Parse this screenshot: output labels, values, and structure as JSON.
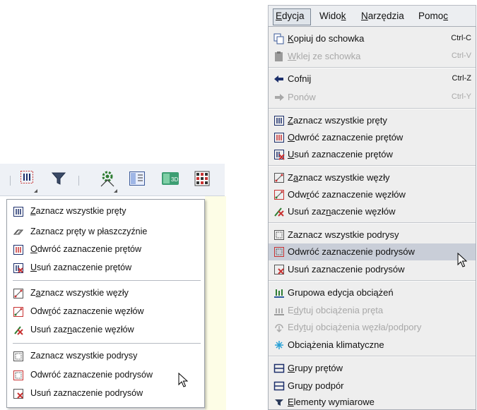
{
  "left_menu": {
    "items": [
      {
        "pre": "",
        "u": "Z",
        "post": "aznacz wszystkie pręty",
        "icon": "bars-grid-icon"
      },
      {
        "pre": "Zaznacz pręty w płaszczyźnie",
        "u": "",
        "post": "",
        "icon": "plane-bars-icon"
      },
      {
        "pre": "",
        "u": "O",
        "post": "dwróć zaznaczenie prętów",
        "icon": "invert-bars-icon"
      },
      {
        "pre": "",
        "u": "U",
        "post": "suń zaznaczenie prętów",
        "icon": "remove-bars-icon"
      },
      {
        "pre": "Z",
        "u": "a",
        "post": "znacz wszystkie węzły",
        "icon": "nodes-icon"
      },
      {
        "pre": "Odw",
        "u": "r",
        "post": "óć zaznaczenie węzłów",
        "icon": "invert-nodes-icon"
      },
      {
        "pre": "Usuń zaz",
        "u": "n",
        "post": "aczenie węzłów",
        "icon": "remove-nodes-icon"
      },
      {
        "pre": "Zaznacz wszystkie podrysy",
        "u": "",
        "post": "",
        "icon": "subdrawings-icon"
      },
      {
        "pre": "Odwróć zaznaczenie podrysów",
        "u": "",
        "post": "",
        "icon": "invert-subdrawings-icon"
      },
      {
        "pre": "Usuń zaznaczenie podrysów",
        "u": "",
        "post": "",
        "icon": "remove-subdrawings-icon"
      }
    ]
  },
  "toolbar": {
    "buttons": [
      "select-dropdown-icon",
      "filter-icon",
      "settings-icon",
      "layout-icon",
      "3d-view-icon",
      "grid-icon"
    ]
  },
  "menubar": {
    "items": [
      {
        "pre": "",
        "u": "E",
        "post": "dycja"
      },
      {
        "pre": "Wido",
        "u": "k",
        "post": ""
      },
      {
        "pre": "",
        "u": "N",
        "post": "arzędzia"
      },
      {
        "pre": "Pomo",
        "u": "c",
        "post": ""
      }
    ]
  },
  "right_menu": {
    "items": [
      {
        "pre": "",
        "u": "K",
        "post": "opiuj do schowka",
        "shortcut": "Ctrl-C",
        "disabled": false,
        "icon": "copy-icon"
      },
      {
        "pre": "",
        "u": "W",
        "post": "klej ze schowka",
        "shortcut": "Ctrl-V",
        "disabled": true,
        "icon": "paste-icon"
      },
      {
        "pre": "Cofnij",
        "u": "",
        "post": "",
        "shortcut": "Ctrl-Z",
        "disabled": false,
        "icon": "undo-icon"
      },
      {
        "pre": "Ponów",
        "u": "",
        "post": "",
        "shortcut": "Ctrl-Y",
        "disabled": true,
        "icon": "redo-icon"
      },
      {
        "pre": "",
        "u": "Z",
        "post": "aznacz wszystkie pręty",
        "shortcut": "",
        "disabled": false,
        "icon": "bars-grid-icon"
      },
      {
        "pre": "",
        "u": "O",
        "post": "dwróć zaznaczenie prętów",
        "shortcut": "",
        "disabled": false,
        "icon": "invert-bars-icon"
      },
      {
        "pre": "",
        "u": "U",
        "post": "suń zaznaczenie prętów",
        "shortcut": "",
        "disabled": false,
        "icon": "remove-bars-icon"
      },
      {
        "pre": "Z",
        "u": "a",
        "post": "znacz wszystkie węzły",
        "shortcut": "",
        "disabled": false,
        "icon": "nodes-icon"
      },
      {
        "pre": "Odw",
        "u": "r",
        "post": "óć zaznaczenie węzłów",
        "shortcut": "",
        "disabled": false,
        "icon": "invert-nodes-icon"
      },
      {
        "pre": "Usuń zaz",
        "u": "n",
        "post": "aczenie węzłów",
        "shortcut": "",
        "disabled": false,
        "icon": "remove-nodes-icon"
      },
      {
        "pre": "Zaznacz wszystkie podrysy",
        "u": "",
        "post": "",
        "shortcut": "",
        "disabled": false,
        "icon": "subdrawings-icon"
      },
      {
        "pre": "Odwróć zaznaczenie podrysów",
        "u": "",
        "post": "",
        "shortcut": "",
        "disabled": false,
        "icon": "invert-subdrawings-icon",
        "highlighted": true
      },
      {
        "pre": "Usuń zaznaczenie podrysów",
        "u": "",
        "post": "",
        "shortcut": "",
        "disabled": false,
        "icon": "remove-subdrawings-icon"
      },
      {
        "pre": "Grupowa edycja obciążeń",
        "u": "",
        "post": "",
        "shortcut": "",
        "disabled": false,
        "icon": "group-loads-icon"
      },
      {
        "pre": "E",
        "u": "d",
        "post": "ytuj obciążenia pręta",
        "shortcut": "",
        "disabled": true,
        "icon": "edit-bar-loads-icon"
      },
      {
        "pre": "Edy",
        "u": "t",
        "post": "uj obciążenia węzła/podpory",
        "shortcut": "",
        "disabled": true,
        "icon": "edit-node-loads-icon"
      },
      {
        "pre": "Obciążenia klimatyczne",
        "u": "",
        "post": "",
        "shortcut": "",
        "disabled": false,
        "icon": "climate-loads-icon"
      },
      {
        "pre": "",
        "u": "G",
        "post": "rupy prętów",
        "shortcut": "",
        "disabled": false,
        "icon": "bar-groups-icon"
      },
      {
        "pre": "Gru",
        "u": "p",
        "post": "y podpór",
        "shortcut": "",
        "disabled": false,
        "icon": "support-groups-icon"
      },
      {
        "pre": "",
        "u": "E",
        "post": "lementy wymiarowe",
        "shortcut": "",
        "disabled": false,
        "icon": "dimension-elements-icon"
      }
    ]
  },
  "colors": {
    "highlight": "#c9ced8",
    "disabled_text": "#a8a8a8",
    "icon_red": "#c83232",
    "icon_green": "#2e7d32",
    "icon_navy": "#1c2f6b"
  }
}
